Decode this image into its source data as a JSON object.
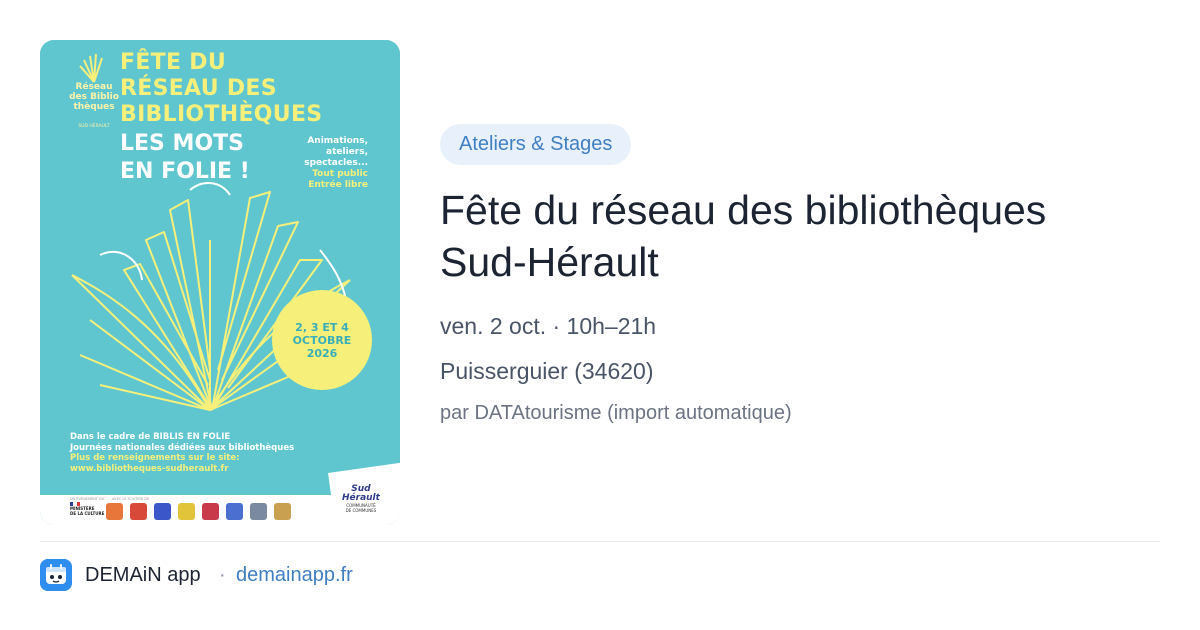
{
  "poster": {
    "logo_lines": [
      "Réseau",
      "des Biblio",
      "thèques"
    ],
    "logo_sub": "SUD HÉRAULT",
    "title_lines": [
      "FÊTE DU",
      "RÉSEAU DES",
      "BIBLIOTHÈQUES"
    ],
    "subtitle_lines": [
      "LES MOTS",
      "EN FOLIE !"
    ],
    "side_lines": [
      "Animations,",
      "ateliers,",
      "spectacles..."
    ],
    "side_highlight": [
      "Tout public",
      "Entrée libre"
    ],
    "date_lines": [
      "2, 3 ET 4",
      "OCTOBRE",
      "2026"
    ],
    "footer_lines": [
      "Dans le cadre de BIBLIS EN FOLIE",
      "Journées nationales dédiées aux bibliothèques"
    ],
    "footer_highlight": [
      "Plus de renseignements sur le site:",
      "www.bibliotheques-sudherault.fr"
    ],
    "sponsor_label_left": "UN ÉVÈNEMENT DU",
    "sponsor_label_right": "AVEC LE SOUTIEN DE",
    "ministere_lines": [
      "MINISTÈRE",
      "DE LA CULTURE"
    ],
    "sudherault_lines": [
      "Sud",
      "Hérault"
    ],
    "sudherault_sub": [
      "COMMUNAUTÉ",
      "DE COMMUNES"
    ],
    "logo_colors": [
      "#e8763a",
      "#d8493a",
      "#3a56c8",
      "#e2c43a",
      "#c83a4a",
      "#4a6fd0",
      "#7a8aa0",
      "#c8a050"
    ]
  },
  "event": {
    "category": "Ateliers & Stages",
    "title_lines": [
      "Fête du réseau des bibliothèques",
      "Sud-Hérault"
    ],
    "datetime": "ven. 2 oct. · 10h–21h",
    "location": "Puisserguier (34620)",
    "author": "par DATAtourisme (import automatique)"
  },
  "footer": {
    "app_icon": "demain-app-icon",
    "app_name": "DEMAiN app",
    "separator": "·",
    "link": "demainapp.fr"
  },
  "colors": {
    "poster_bg": "#5fc6cf",
    "poster_yellow": "#f6f07a",
    "badge_bg": "#e8f1fb",
    "accent": "#3f7fc2",
    "app_icon_bg": "#2f8df0"
  }
}
